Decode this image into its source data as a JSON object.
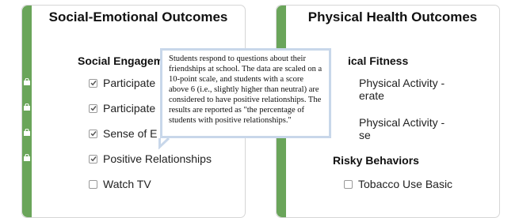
{
  "left_card": {
    "title": "Social-Emotional Outcomes",
    "section": "Social Engagement",
    "items": [
      {
        "label": "Participate in ...",
        "checked": true
      },
      {
        "label": "Participate in ...",
        "checked": true
      },
      {
        "label": "Sense of Belonging",
        "checked": true
      },
      {
        "label": "Positive Relationships",
        "checked": true
      },
      {
        "label": "Watch TV",
        "checked": false
      }
    ],
    "visible_items": [
      "Participate",
      "Participate",
      "Sense of E",
      "Positive Relationships",
      "Watch TV"
    ]
  },
  "right_card": {
    "title": "Physical Health Outcomes",
    "section1": "Physical Fitness",
    "section1_visible": "ical Fitness",
    "items": [
      {
        "line1": "Physical Activity -",
        "line2": "erate",
        "checked": false
      },
      {
        "line1": "Physical Activity -",
        "line2": "se",
        "checked": false
      }
    ],
    "section2": "Risky Behaviors",
    "items2": [
      {
        "label": "Tobacco Use Basic",
        "checked": false
      }
    ]
  },
  "tooltip": {
    "text": "Students respond to questions about their friendships at school. The data are scaled on a 10-point scale, and students with a score above 6 (i.e., slightly higher than neutral) are considered to have positive relationships. The results are reported as \"the percentage of students with positive relationships.\""
  },
  "colors": {
    "accent": "#6aa55a",
    "tooltip_border": "#c8d7ea"
  }
}
